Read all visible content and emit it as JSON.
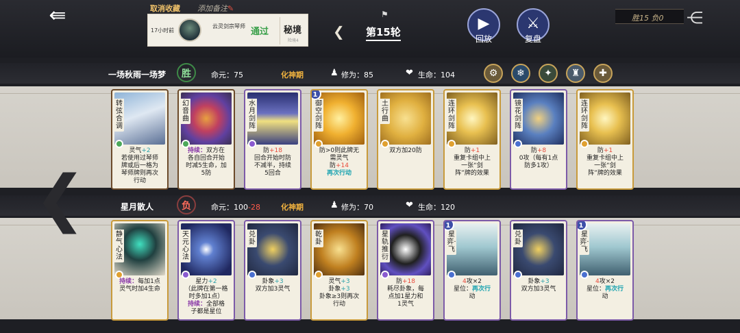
{
  "header": {
    "back_icon": "back-arrow-icon",
    "cancel_favorite": "取消收藏",
    "add_note": "添加备注",
    "record": {
      "time": "17小时前",
      "sect": "云灵剑宗琴师",
      "result": "通过",
      "realm": "秘境",
      "realm_sub": "险境4"
    },
    "round_label": "第15轮",
    "replay_label": "回放",
    "review_label": "复盘",
    "win_loss": "胜15 负0"
  },
  "player1": {
    "name": "一场秋雨一场梦",
    "result": "胜",
    "life_essence_label": "命元：",
    "life_essence_value": "75",
    "realm": "化神期",
    "cultivation_label": "修为：",
    "cultivation_value": "85",
    "hp_label": "生命：",
    "hp_value": "104"
  },
  "player2": {
    "name": "星月散人",
    "result": "负",
    "life_essence_label": "命元：",
    "life_essence_value": "100",
    "life_essence_loss": "-28",
    "realm": "化神期",
    "cultivation_label": "修为：",
    "cultivation_value": "70",
    "hp_label": "生命：",
    "hp_value": "120"
  },
  "row1_cards": [
    {
      "name": "转弦合调",
      "lines": [
        "灵气+2",
        "若使用过琴师",
        "牌或后一格为",
        "琴师牌则再次",
        "行动"
      ]
    },
    {
      "name": "幻音曲",
      "lines": [
        "持续：双方在",
        "各自回合开始",
        "时减5生命，加",
        "5防"
      ]
    },
    {
      "name": "水月剑阵",
      "lines": [
        "防+18",
        "回合开始时防",
        "不减半，持续",
        "5回合"
      ]
    },
    {
      "name": "御空剑阵",
      "level": "1",
      "lines": [
        "防>0则此牌无",
        "需灵气",
        "防+14",
        "再次行动"
      ]
    },
    {
      "name": "土行曲",
      "lines": [
        "双方加20防"
      ]
    },
    {
      "name": "连环剑阵",
      "lines": [
        "防+1",
        "重复卡组中上",
        "一张“剑",
        "阵”牌的效果"
      ]
    },
    {
      "name": "镜花剑阵",
      "lines": [
        "防+8",
        "0攻（每有1点",
        "防多1攻）"
      ]
    },
    {
      "name": "连环剑阵",
      "lines": [
        "防+1",
        "重复卡组中上",
        "一张“剑",
        "阵”牌的效果"
      ]
    }
  ],
  "row2_cards": [
    {
      "name": "静气心法",
      "lines": [
        "持续：每加1点",
        "灵气时加4生命"
      ]
    },
    {
      "name": "天元心法",
      "lines": [
        "星力+2",
        "（此牌在第一格",
        "时多加1点）",
        "持续：全部格",
        "子都是星位"
      ]
    },
    {
      "name": "兑卦",
      "lines": [
        "卦象+3",
        "双方加3灵气"
      ]
    },
    {
      "name": "乾卦",
      "lines": [
        "灵气+3",
        "卦象+3",
        "卦象≥3则再次",
        "行动"
      ]
    },
    {
      "name": "星轨推衍",
      "lines": [
        "防+18",
        "耗尽卦象，每",
        "点加1星力和",
        "1灵气"
      ]
    },
    {
      "name": "星弈·飞",
      "level": "1",
      "lines": [
        "4攻×2",
        "星位：再次行",
        "动"
      ]
    },
    {
      "name": "兑卦",
      "lines": [
        "卦象+3",
        "双方加3灵气"
      ]
    },
    {
      "name": "星弈·飞",
      "level": "1",
      "lines": [
        "4攻×2",
        "星位：再次行",
        "动"
      ]
    }
  ]
}
